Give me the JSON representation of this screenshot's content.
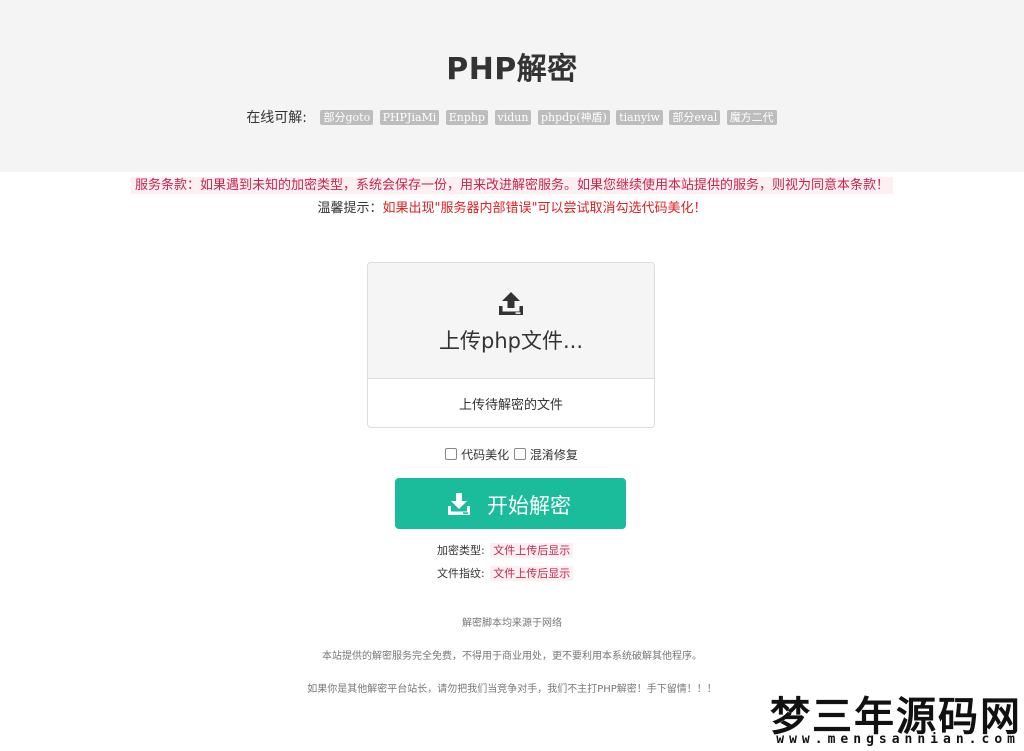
{
  "header": {
    "title": "PHP解密",
    "online_label": "在线可解:",
    "tags": [
      "部分goto",
      "PHPJiaMi",
      "Enphp",
      "vidun",
      "phpdp(神盾)",
      "tianyiw",
      "部分eval",
      "魔方二代"
    ]
  },
  "notices": {
    "terms": "服务条款：如果遇到未知的加密类型，系统会保存一份，用来改进解密服务。如果您继续使用本站提供的服务，则视为同意本条款！",
    "tip_label": "温馨提示：",
    "tip_text": "如果出现\"服务器内部错误\"可以尝试取消勾选代码美化！"
  },
  "upload": {
    "icon": "upload-icon",
    "label": "上传php文件...",
    "hint": "上传待解密的文件"
  },
  "options": [
    {
      "label": "代码美化",
      "checked": false
    },
    {
      "label": "混淆修复",
      "checked": false
    }
  ],
  "start_button": {
    "icon": "download-icon",
    "label": "开始解密"
  },
  "info": {
    "encrypt_type_label": "加密类型:",
    "encrypt_type_value": "文件上传后显示",
    "fingerprint_label": "文件指纹:",
    "fingerprint_value": "文件上传后显示"
  },
  "footer": {
    "line1": "解密脚本均来源于网络",
    "line2": "本站提供的解密服务完全免费，不得用于商业用处，更不要利用本系统破解其他程序。",
    "line3": "如果你是其他解密平台站长，请勿把我们当竞争对手，我们不主打PHP解密！手下留情！！！"
  },
  "watermark": {
    "main": "梦三年源码网",
    "sub": "www.mengsannian.com"
  },
  "colors": {
    "accent": "#1abc9c",
    "header_bg": "#f4f4f4",
    "tag_bg": "#bdbdbd",
    "code_text": "#c7254e",
    "code_bg": "#fcf0f2",
    "warning": "#e02020"
  }
}
